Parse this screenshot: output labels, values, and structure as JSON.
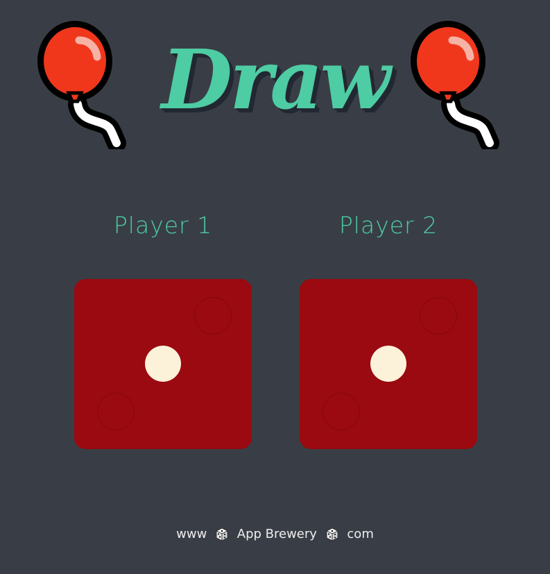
{
  "header": {
    "title": "Draw",
    "left_icon": "balloon-icon",
    "right_icon": "balloon-icon"
  },
  "players": [
    {
      "label": "Player 1",
      "dice_value": 1
    },
    {
      "label": "Player 2",
      "dice_value": 1
    }
  ],
  "footer": {
    "part1": "www",
    "part2": "App Brewery",
    "part3": "com",
    "separator_icon": "game-die-icon"
  },
  "colors": {
    "background": "#393e46",
    "accent": "#4ecca3",
    "dice": "#9a0a10",
    "pip": "#fcf1d9",
    "balloon": "#f0371c"
  }
}
